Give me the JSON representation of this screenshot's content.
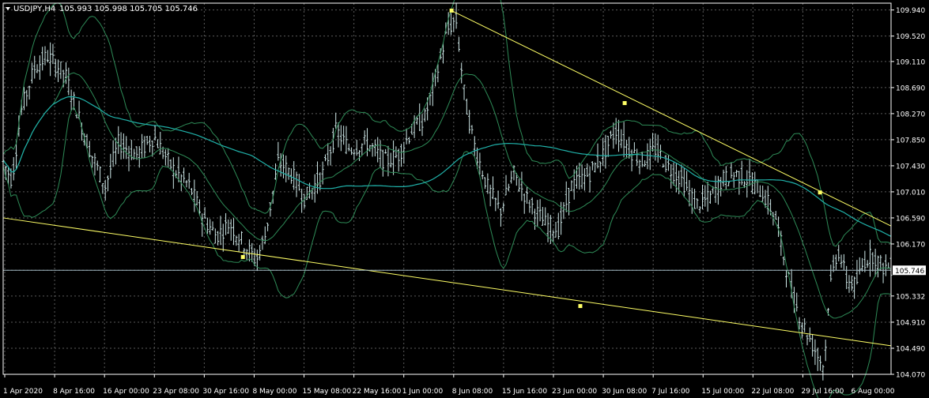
{
  "window": {
    "symbol_label": "USDJPY,H4",
    "ohlc_label": "105.993 105.998 105.705 105.746",
    "menu_icon": "triangle-down-icon"
  },
  "colors": {
    "background": "#000000",
    "grid": "#5a5a5a",
    "frame": "#ffffff",
    "bars": "#cfe8e8",
    "bollinger": "#2e8b57",
    "moving_average": "#20b2aa",
    "trendline": "#ffff66",
    "anchor": "#ffff66",
    "price_line": "#9fb6c0",
    "price_box_bg": "#ffffff",
    "price_box_text": "#000000"
  },
  "chart_data": {
    "type": "candlestick",
    "symbol": "USDJPY",
    "timeframe": "H4",
    "current_price": "105.746",
    "ylim": [
      104.07,
      110.05
    ],
    "y_ticks": [
      "109.940",
      "109.520",
      "109.110",
      "108.690",
      "108.270",
      "107.850",
      "107.430",
      "107.010",
      "106.590",
      "106.170",
      "105.746",
      "105.332",
      "104.910",
      "104.490",
      "104.070"
    ],
    "x_ticks": [
      "1 Apr 2020",
      "8 Apr 16:00",
      "16 Apr 00:00",
      "23 Apr 08:00",
      "30 Apr 16:00",
      "8 May 00:00",
      "15 May 08:00",
      "22 May 16:00",
      "1 Jun 00:00",
      "8 Jun 08:00",
      "15 Jun 16:00",
      "23 Jun 00:00",
      "30 Jun 08:00",
      "7 Jul 16:00",
      "15 Jul 00:00",
      "22 Jul 08:00",
      "29 Jul 16:00",
      "6 Aug 00:00"
    ],
    "price_path": [
      [
        0,
        107.5
      ],
      [
        0.01,
        107.2
      ],
      [
        0.02,
        108.3
      ],
      [
        0.035,
        109.0
      ],
      [
        0.05,
        109.2
      ],
      [
        0.07,
        108.9
      ],
      [
        0.09,
        108.0
      ],
      [
        0.1,
        107.6
      ],
      [
        0.115,
        107.1
      ],
      [
        0.13,
        107.8
      ],
      [
        0.15,
        107.6
      ],
      [
        0.17,
        107.9
      ],
      [
        0.19,
        107.4
      ],
      [
        0.21,
        107.1
      ],
      [
        0.225,
        106.6
      ],
      [
        0.24,
        106.3
      ],
      [
        0.255,
        106.5
      ],
      [
        0.27,
        106.2
      ],
      [
        0.285,
        105.9
      ],
      [
        0.295,
        106.3
      ],
      [
        0.31,
        107.5
      ],
      [
        0.325,
        107.3
      ],
      [
        0.34,
        106.9
      ],
      [
        0.36,
        107.3
      ],
      [
        0.375,
        108.0
      ],
      [
        0.39,
        107.7
      ],
      [
        0.41,
        107.8
      ],
      [
        0.43,
        107.5
      ],
      [
        0.445,
        107.6
      ],
      [
        0.46,
        108.0
      ],
      [
        0.475,
        108.2
      ],
      [
        0.49,
        109.0
      ],
      [
        0.5,
        109.6
      ],
      [
        0.51,
        109.8
      ],
      [
        0.52,
        108.5
      ],
      [
        0.53,
        107.8
      ],
      [
        0.545,
        107.1
      ],
      [
        0.56,
        106.7
      ],
      [
        0.575,
        107.3
      ],
      [
        0.59,
        106.9
      ],
      [
        0.61,
        106.5
      ],
      [
        0.625,
        106.4
      ],
      [
        0.64,
        107.1
      ],
      [
        0.66,
        107.3
      ],
      [
        0.675,
        107.6
      ],
      [
        0.69,
        108.0
      ],
      [
        0.705,
        107.7
      ],
      [
        0.72,
        107.5
      ],
      [
        0.735,
        107.7
      ],
      [
        0.75,
        107.4
      ],
      [
        0.765,
        107.2
      ],
      [
        0.78,
        106.8
      ],
      [
        0.795,
        106.9
      ],
      [
        0.81,
        107.2
      ],
      [
        0.825,
        107.3
      ],
      [
        0.84,
        107.2
      ],
      [
        0.855,
        107.0
      ],
      [
        0.87,
        106.6
      ],
      [
        0.88,
        105.9
      ],
      [
        0.89,
        105.3
      ],
      [
        0.9,
        104.9
      ],
      [
        0.91,
        104.6
      ],
      [
        0.92,
        104.3
      ],
      [
        0.925,
        104.2
      ],
      [
        0.93,
        105.4
      ],
      [
        0.94,
        106.1
      ],
      [
        0.95,
        105.6
      ],
      [
        0.96,
        105.5
      ],
      [
        0.97,
        105.9
      ],
      [
        0.98,
        106.0
      ],
      [
        0.99,
        105.8
      ]
    ],
    "upper_trendline": {
      "from": [
        0.505,
        109.93
      ],
      "to": [
        1.0,
        106.46
      ],
      "anchors": [
        [
          0.505,
          109.93
        ],
        [
          0.7,
          108.44
        ],
        [
          0.92,
          107.0
        ]
      ]
    },
    "lower_trendline": {
      "from": [
        0.0,
        106.59
      ],
      "to": [
        1.0,
        104.53
      ],
      "anchors": [
        [
          0.27,
          105.96
        ],
        [
          0.65,
          105.17
        ]
      ]
    }
  }
}
